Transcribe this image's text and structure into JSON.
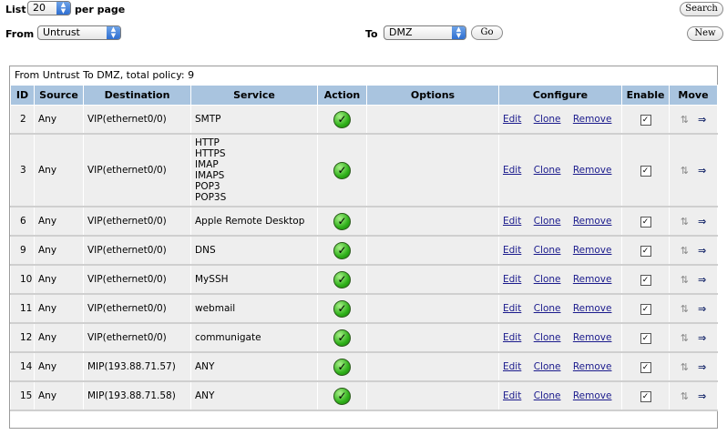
{
  "controls": {
    "list_label": "List",
    "list_value": "20",
    "per_page_label": "per page",
    "from_label": "From",
    "from_value": "Untrust",
    "to_label": "To",
    "to_value": "DMZ",
    "go_label": "Go",
    "search_label": "Search",
    "new_label": "New"
  },
  "table": {
    "caption": "From Untrust To DMZ, total policy: 9",
    "headers": [
      "ID",
      "Source",
      "Destination",
      "Service",
      "Action",
      "Options",
      "Configure",
      "Enable",
      "Move"
    ],
    "link_edit": "Edit",
    "link_clone": "Clone",
    "link_remove": "Remove",
    "rows": [
      {
        "id": "2",
        "source": "Any",
        "destination": "VIP(ethernet0/0)",
        "service": [
          "SMTP"
        ]
      },
      {
        "id": "3",
        "source": "Any",
        "destination": "VIP(ethernet0/0)",
        "service": [
          "HTTP",
          "HTTPS",
          "IMAP",
          "IMAPS",
          "POP3",
          "POP3S"
        ]
      },
      {
        "id": "6",
        "source": "Any",
        "destination": "VIP(ethernet0/0)",
        "service": [
          "Apple Remote Desktop"
        ]
      },
      {
        "id": "9",
        "source": "Any",
        "destination": "VIP(ethernet0/0)",
        "service": [
          "DNS"
        ]
      },
      {
        "id": "10",
        "source": "Any",
        "destination": "VIP(ethernet0/0)",
        "service": [
          "MySSH"
        ]
      },
      {
        "id": "11",
        "source": "Any",
        "destination": "VIP(ethernet0/0)",
        "service": [
          "webmail"
        ]
      },
      {
        "id": "12",
        "source": "Any",
        "destination": "VIP(ethernet0/0)",
        "service": [
          "communigate"
        ]
      },
      {
        "id": "14",
        "source": "Any",
        "destination": "MIP(193.88.71.57)",
        "service": [
          "ANY"
        ]
      },
      {
        "id": "15",
        "source": "Any",
        "destination": "MIP(193.88.71.58)",
        "service": [
          "ANY"
        ]
      }
    ]
  },
  "icons": {
    "action": "permit-check-icon",
    "enable": "checkbox-checked",
    "move_cycle": "move-cycle-icon",
    "move_arrow": "move-arrow-icon"
  },
  "colors": {
    "header_bg": "#a9c4df",
    "row_bg": "#eeeeee",
    "link": "#1a1a8c",
    "permit_green": "#2fb11a"
  }
}
